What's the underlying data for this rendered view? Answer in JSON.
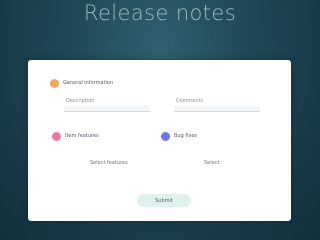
{
  "header": {
    "title": "Release notes",
    "subtitle_line1": "",
    "subtitle_line2": ""
  },
  "form": {
    "section_general": {
      "label": "General information",
      "icon": "orange-circle-icon",
      "color": "#f0a85a"
    },
    "field_left": {
      "label": "Description",
      "value": ""
    },
    "field_right": {
      "label": "Comments",
      "value": ""
    },
    "section_left": {
      "label": "Item features",
      "icon": "pink-circle-icon",
      "color": "#e87aa0",
      "select_value": "Select features"
    },
    "section_right": {
      "label": "Bug fixes",
      "icon": "blue-circle-icon",
      "color": "#6e74e0",
      "select_value": "Select"
    },
    "submit_label": "Submit"
  }
}
